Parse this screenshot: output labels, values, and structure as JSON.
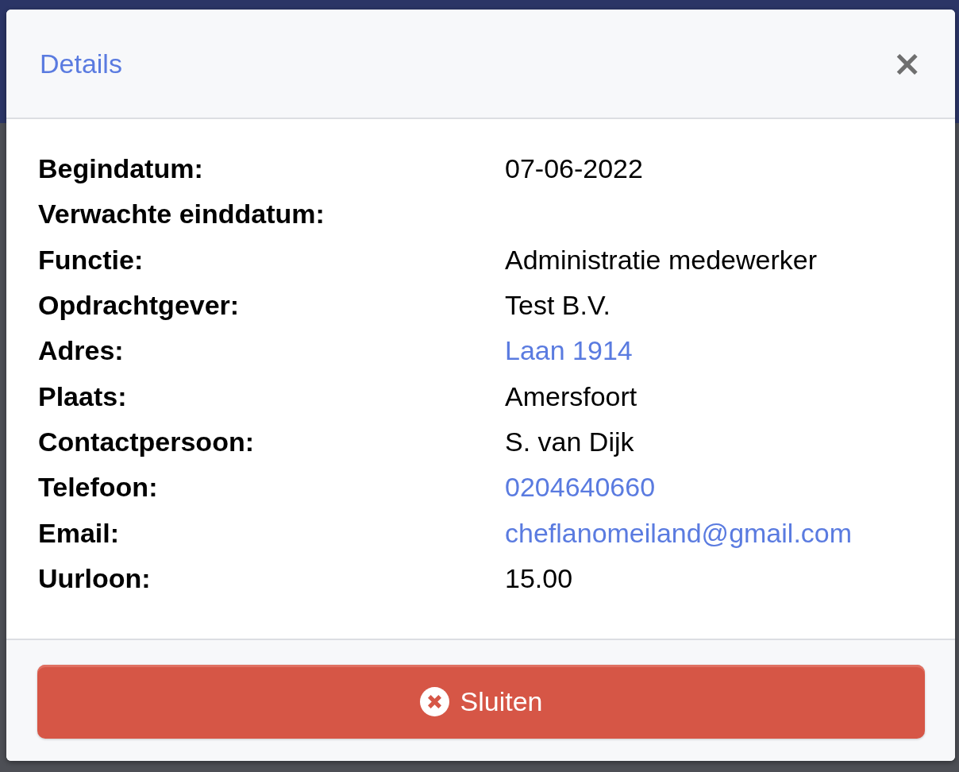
{
  "dialog": {
    "title": "Details",
    "close_glyph": "×",
    "rows": [
      {
        "label": "Begindatum:",
        "value": "07-06-2022",
        "kind": "text"
      },
      {
        "label": "Verwachte einddatum:",
        "kind": "empty"
      },
      {
        "label": "Functie:",
        "value": "Administratie medewerker",
        "kind": "text"
      },
      {
        "label": "Opdrachtgever:",
        "value": "Test B.V.",
        "kind": "text"
      },
      {
        "label": "Adres:",
        "value": "Laan 1914",
        "kind": "link"
      },
      {
        "label": "Plaats:",
        "value": "Amersfoort",
        "kind": "text"
      },
      {
        "label": "Contactpersoon:",
        "value": "S. van Dijk",
        "kind": "text"
      },
      {
        "label": "Telefoon:",
        "value": "0204640660",
        "kind": "link"
      },
      {
        "label": "Email:",
        "value": "cheflanomeiland@gmail.com",
        "kind": "link"
      },
      {
        "label": "Uurloon:",
        "value": "15.00",
        "kind": "text"
      }
    ],
    "button": {
      "label": "Sluiten"
    }
  }
}
